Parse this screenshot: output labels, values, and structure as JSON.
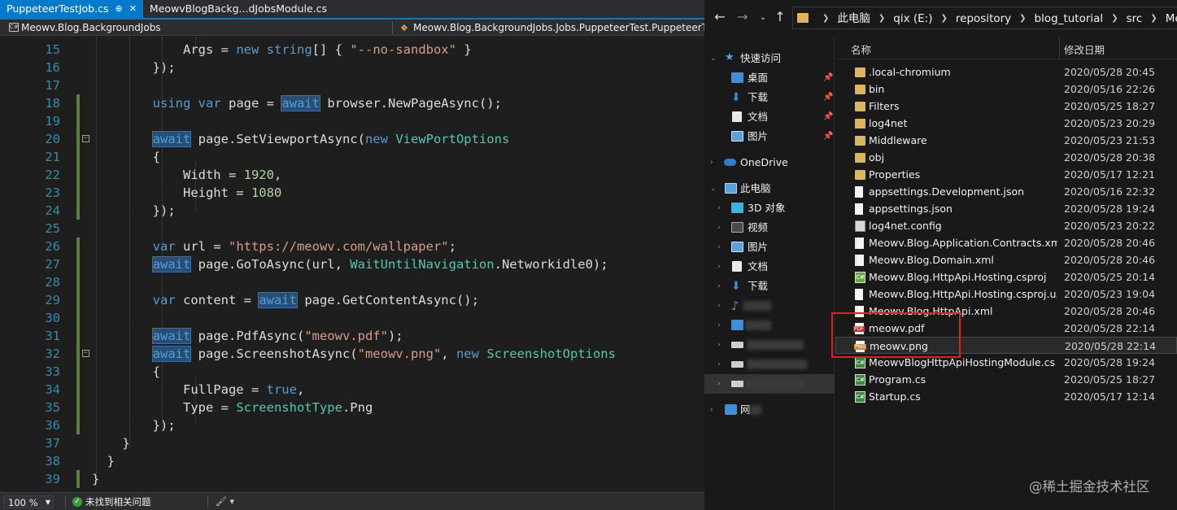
{
  "vs": {
    "tabs": [
      {
        "label": "PuppeteerTestJob.cs",
        "pin": "⊕",
        "close": "✕"
      },
      {
        "label": "MeowvBlogBackg...dJobsModule.cs"
      }
    ],
    "nav": {
      "project": "Meowv.Blog.BackgroundJobs",
      "type": "Meowv.Blog.BackgroundJobs.Jobs.PuppeteerTest.PuppeteerT"
    },
    "lines": [
      {
        "n": "15",
        "code": "            Args = new string[] { \"--no-sandbox\" }"
      },
      {
        "n": "16",
        "code": "        });"
      },
      {
        "n": "17",
        "code": ""
      },
      {
        "n": "18",
        "code": "        using var page = await browser.NewPageAsync();"
      },
      {
        "n": "19",
        "code": ""
      },
      {
        "n": "20",
        "code": "        await page.SetViewportAsync(new ViewPortOptions"
      },
      {
        "n": "21",
        "code": "        {"
      },
      {
        "n": "22",
        "code": "            Width = 1920,"
      },
      {
        "n": "23",
        "code": "            Height = 1080"
      },
      {
        "n": "24",
        "code": "        });"
      },
      {
        "n": "25",
        "code": ""
      },
      {
        "n": "26",
        "code": "        var url = \"https://meowv.com/wallpaper\";"
      },
      {
        "n": "27",
        "code": "        await page.GoToAsync(url, WaitUntilNavigation.Networkidle0);"
      },
      {
        "n": "28",
        "code": ""
      },
      {
        "n": "29",
        "code": "        var content = await page.GetContentAsync();"
      },
      {
        "n": "30",
        "code": ""
      },
      {
        "n": "31",
        "code": "        await page.PdfAsync(\"meowv.pdf\");"
      },
      {
        "n": "32",
        "code": "        await page.ScreenshotAsync(\"meowv.png\", new ScreenshotOptions"
      },
      {
        "n": "33",
        "code": "        {"
      },
      {
        "n": "34",
        "code": "            FullPage = true,"
      },
      {
        "n": "35",
        "code": "            Type = ScreenshotType.Png"
      },
      {
        "n": "36",
        "code": "        });"
      },
      {
        "n": "37",
        "code": "    }"
      },
      {
        "n": "38",
        "code": "  }"
      },
      {
        "n": "39",
        "code": "}"
      }
    ],
    "status": {
      "zoom": "100 %",
      "issues": "未找到相关问题"
    },
    "colors": {
      "accent": "#007acc",
      "keyword": "#569cd6",
      "type": "#4ec9b0",
      "string": "#d69d85",
      "line_number": "#2b91af",
      "change_bar": "#57803e"
    }
  },
  "explorer": {
    "address": {
      "crumbs": [
        "此电脑",
        "qix (E:)",
        "repository",
        "blog_tutorial",
        "src",
        "Meowv.Blog."
      ]
    },
    "nav": {
      "quick_access": "快速访问",
      "desktop": "桌面",
      "downloads_quick": "下载",
      "documents_quick": "文档",
      "pictures_quick": "图片",
      "onedrive": "OneDrive",
      "this_pc": "此电脑",
      "objects3d": "3D 对象",
      "videos": "视频",
      "pictures": "图片",
      "documents": "文档",
      "downloads": "下载",
      "network_partial": "网"
    },
    "columns": {
      "name": "名称",
      "date": "修改日期"
    },
    "files": [
      {
        "name": ".local-chromium",
        "date": "2020/05/28 20:45",
        "icon": "folder-icon"
      },
      {
        "name": "bin",
        "date": "2020/05/16 22:26",
        "icon": "folder-icon"
      },
      {
        "name": "Filters",
        "date": "2020/05/25 18:27",
        "icon": "folder-icon"
      },
      {
        "name": "log4net",
        "date": "2020/05/23 20:29",
        "icon": "folder-icon"
      },
      {
        "name": "Middleware",
        "date": "2020/05/23 21:53",
        "icon": "folder-icon"
      },
      {
        "name": "obj",
        "date": "2020/05/28 20:38",
        "icon": "folder-icon"
      },
      {
        "name": "Properties",
        "date": "2020/05/17 12:21",
        "icon": "folder-icon"
      },
      {
        "name": "appsettings.Development.json",
        "date": "2020/05/16 22:32",
        "icon": "json-file-icon"
      },
      {
        "name": "appsettings.json",
        "date": "2020/05/28 19:24",
        "icon": "json-file-icon"
      },
      {
        "name": "log4net.config",
        "date": "2020/05/23 20:22",
        "icon": "config-file-icon"
      },
      {
        "name": "Meowv.Blog.Application.Contracts.xml",
        "date": "2020/05/28 20:46",
        "icon": "xml-file-icon"
      },
      {
        "name": "Meowv.Blog.Domain.xml",
        "date": "2020/05/28 20:46",
        "icon": "xml-file-icon"
      },
      {
        "name": "Meowv.Blog.HttpApi.Hosting.csproj",
        "date": "2020/05/25 20:14",
        "icon": "csproj-file-icon"
      },
      {
        "name": "Meowv.Blog.HttpApi.Hosting.csproj.u...",
        "date": "2020/05/23 19:04",
        "icon": "file-icon"
      },
      {
        "name": "Meowv.Blog.HttpApi.xml",
        "date": "2020/05/28 20:46",
        "icon": "xml-file-icon"
      },
      {
        "name": "meowv.pdf",
        "date": "2020/05/28 22:14",
        "icon": "pdf-file-icon"
      },
      {
        "name": "meowv.png",
        "date": "2020/05/28 22:14",
        "icon": "png-file-icon"
      },
      {
        "name": "MeowvBlogHttpApiHostingModule.cs",
        "date": "2020/05/28 19:24",
        "icon": "cs-file-icon"
      },
      {
        "name": "Program.cs",
        "date": "2020/05/25 18:27",
        "icon": "cs-file-icon"
      },
      {
        "name": "Startup.cs",
        "date": "2020/05/17 12:14",
        "icon": "cs-file-icon"
      }
    ]
  },
  "watermark": "@稀土掘金技术社区"
}
